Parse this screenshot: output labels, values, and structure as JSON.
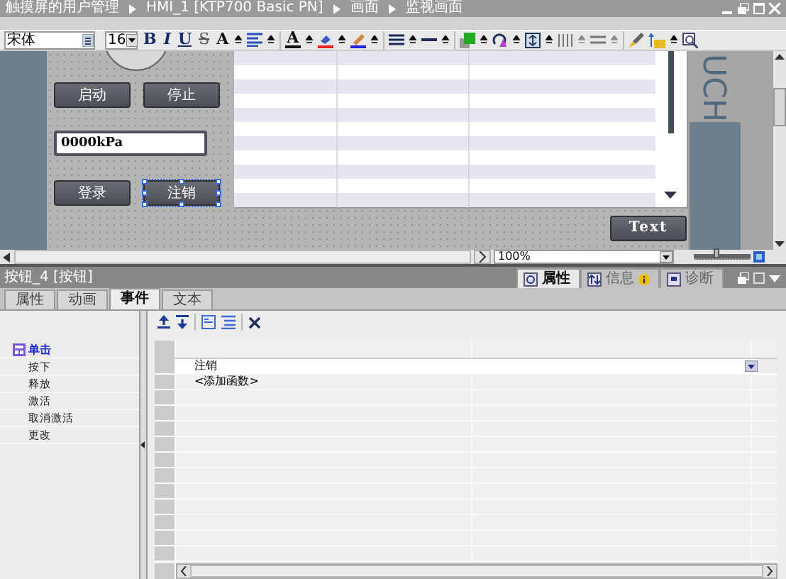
{
  "window": {
    "breadcrumb": [
      "触摸屏的用户管理",
      "HMI_1 [KTP700 Basic PN]",
      "画面",
      "监视画面"
    ]
  },
  "toolbar": {
    "font": "宋体",
    "size": "16",
    "text_buttons": [
      "B",
      "I",
      "U",
      "S",
      "A"
    ],
    "color_letter": "A"
  },
  "screen": {
    "buttons": [
      {
        "label": "启动",
        "selected": false
      },
      {
        "label": "停止",
        "selected": false
      },
      {
        "label": "登录",
        "selected": false
      },
      {
        "label": "注销",
        "selected": true
      },
      {
        "label": "Text",
        "selected": false
      }
    ],
    "io_field": "0000kPa",
    "device_label": "UCH"
  },
  "zoom": "100%",
  "zoom_slider": {
    "level": 0.4
  },
  "inspector": {
    "title": "按钮_4 [按钮]",
    "panel_tabs": [
      {
        "label": "属性",
        "selected": true
      },
      {
        "label": "信息",
        "selected": false
      },
      {
        "label": "诊断",
        "selected": false
      }
    ],
    "tabs": [
      {
        "label": "属性",
        "selected": false
      },
      {
        "label": "动画",
        "selected": false
      },
      {
        "label": "事件",
        "selected": true
      },
      {
        "label": "文本",
        "selected": false
      }
    ],
    "events": [
      {
        "label": "单击",
        "selected": true,
        "configured": true
      },
      {
        "label": "按下",
        "selected": false,
        "configured": false
      },
      {
        "label": "释放",
        "selected": false,
        "configured": false
      },
      {
        "label": "激活",
        "selected": false,
        "configured": false
      },
      {
        "label": "取消激活",
        "selected": false,
        "configured": false
      },
      {
        "label": "更改",
        "selected": false,
        "configured": false
      }
    ],
    "functions": [
      {
        "kind": "function",
        "text": "注销"
      },
      {
        "kind": "add",
        "text": "<添加函数>"
      }
    ]
  }
}
